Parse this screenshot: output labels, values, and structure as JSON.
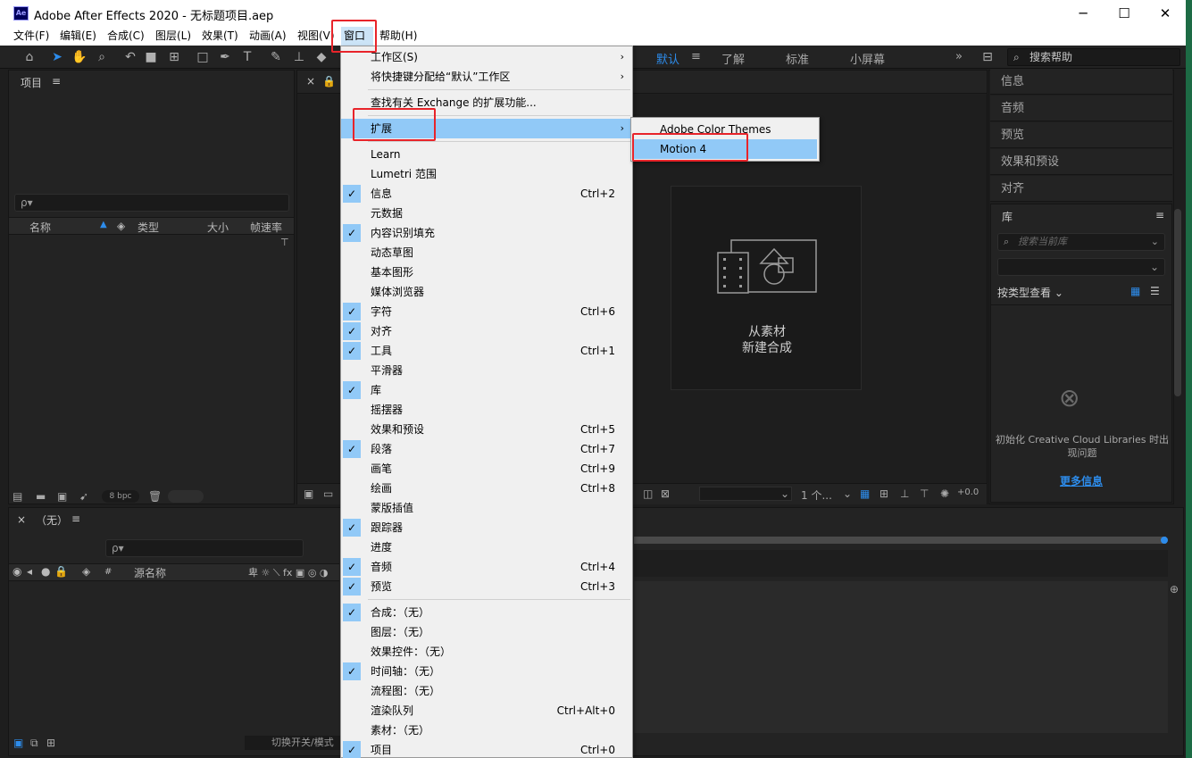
{
  "window": {
    "app_icon": "Ae",
    "title": "Adobe After Effects 2020 - 无标题项目.aep",
    "minimize": "─",
    "maximize": "☐",
    "close": "✕"
  },
  "menubar": [
    {
      "label": "文件(F)"
    },
    {
      "label": "编辑(E)"
    },
    {
      "label": "合成(C)"
    },
    {
      "label": "图层(L)"
    },
    {
      "label": "效果(T)"
    },
    {
      "label": "动画(A)"
    },
    {
      "label": "视图(V)"
    },
    {
      "label": "窗口"
    },
    {
      "label": "帮助(H)"
    }
  ],
  "toolbar": {
    "workspaces": [
      "默认",
      "了解",
      "标准",
      "小屏幕"
    ],
    "workspace_menu_icon": "≡",
    "overflow": "»",
    "search_help_placeholder": "搜索帮助"
  },
  "project_panel": {
    "title": "项目",
    "menu": "≡",
    "search_placeholder": "ρ▾",
    "columns": {
      "name": "名称",
      "type": "类型",
      "size": "大小",
      "fps": "帧速率"
    },
    "bpc": "8 bpc"
  },
  "comp_tab": {
    "close": "×"
  },
  "new_comp": {
    "line1": "从素材",
    "line2": "新建合成"
  },
  "right_panel": {
    "items": [
      "信息",
      "音频",
      "预览",
      "效果和预设",
      "对齐"
    ],
    "library_title": "库",
    "library_menu": "≡",
    "library_search": "搜索当前库",
    "view_by": "按类型查看",
    "cc_error": "初始化 Creative Cloud Libraries 时出现问题",
    "more_info": "更多信息"
  },
  "timeline": {
    "close": "×",
    "title": "（无）",
    "menu": "≡",
    "search_placeholder": "ρ▾",
    "source_name": "源名称",
    "hash": "#",
    "toggle_modes": "切换开关/模式"
  },
  "comp_footer": {
    "count": "1 个...",
    "offset": "+0.0"
  },
  "window_menu": {
    "items": [
      {
        "label": "工作区(S)",
        "arrow": "›",
        "checked": false
      },
      {
        "label": "将快捷键分配给“默认”工作区",
        "arrow": "›",
        "checked": false
      },
      {
        "label": "查找有关 Exchange 的扩展功能...",
        "checked": false
      },
      {
        "label": "扩展",
        "arrow": "›",
        "checked": false,
        "highlight": true
      },
      {
        "label": "Learn",
        "checked": false
      },
      {
        "label": "Lumetri 范围",
        "checked": false
      },
      {
        "label": "信息",
        "shortcut": "Ctrl+2",
        "checked": true
      },
      {
        "label": "元数据",
        "checked": false
      },
      {
        "label": "内容识别填充",
        "checked": true
      },
      {
        "label": "动态草图",
        "checked": false
      },
      {
        "label": "基本图形",
        "checked": false
      },
      {
        "label": "媒体浏览器",
        "checked": false
      },
      {
        "label": "字符",
        "shortcut": "Ctrl+6",
        "checked": true
      },
      {
        "label": "对齐",
        "checked": true
      },
      {
        "label": "工具",
        "shortcut": "Ctrl+1",
        "checked": true
      },
      {
        "label": "平滑器",
        "checked": false
      },
      {
        "label": "库",
        "checked": true
      },
      {
        "label": "摇摆器",
        "checked": false
      },
      {
        "label": "效果和预设",
        "shortcut": "Ctrl+5",
        "checked": false
      },
      {
        "label": "段落",
        "shortcut": "Ctrl+7",
        "checked": true
      },
      {
        "label": "画笔",
        "shortcut": "Ctrl+9",
        "checked": false
      },
      {
        "label": "绘画",
        "shortcut": "Ctrl+8",
        "checked": false
      },
      {
        "label": "蒙版插值",
        "checked": false
      },
      {
        "label": "跟踪器",
        "checked": true
      },
      {
        "label": "进度",
        "checked": false
      },
      {
        "label": "音频",
        "shortcut": "Ctrl+4",
        "checked": true
      },
      {
        "label": "预览",
        "shortcut": "Ctrl+3",
        "checked": true
      },
      {
        "label": "合成：（无）",
        "checked": true
      },
      {
        "label": "图层：（无）",
        "checked": false
      },
      {
        "label": "效果控件：（无）",
        "checked": false
      },
      {
        "label": "时间轴：（无）",
        "checked": true
      },
      {
        "label": "流程图：（无）",
        "checked": false
      },
      {
        "label": "渲染队列",
        "shortcut": "Ctrl+Alt+0",
        "checked": false
      },
      {
        "label": "素材：（无）",
        "checked": false
      },
      {
        "label": "项目",
        "shortcut": "Ctrl+0",
        "checked": true
      }
    ],
    "check_glyph": "✓"
  },
  "extensions_submenu": {
    "items": [
      {
        "label": "Adobe Color Themes"
      },
      {
        "label": "Motion 4",
        "highlight": true
      }
    ]
  },
  "colors": {
    "accent": "#2d8ceb",
    "menu_highlight": "#91c9f7",
    "annotation_red": "#e8242a"
  }
}
